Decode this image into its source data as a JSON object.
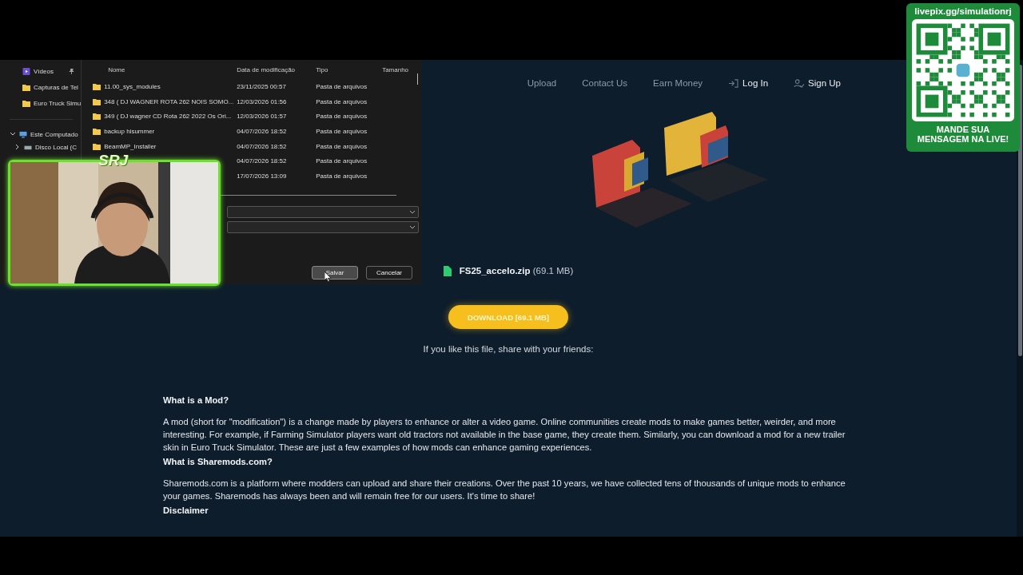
{
  "stream_overlay": {
    "channel_logo": "SRJ",
    "qr_panel": {
      "url": "livepix.gg/simulationrj",
      "message": "MANDE SUA\nMENSAGEM NA LIVE!"
    }
  },
  "save_dialog": {
    "sidebar": [
      {
        "label": "Vídeos",
        "kind": "video",
        "pinned": true
      },
      {
        "label": "Capturas de Tel",
        "kind": "folder",
        "pinned": false
      },
      {
        "label": "Euro Truck Simu",
        "kind": "folder",
        "pinned": false
      }
    ],
    "tree": [
      {
        "label": "Este Computado",
        "kind": "computer",
        "expanded": true,
        "children": [
          {
            "label": "Disco Local (C",
            "kind": "drive",
            "expanded": false
          }
        ]
      }
    ],
    "columns": [
      "Nome",
      "Data de modificação",
      "Tipo",
      "Tamanho"
    ],
    "rows": [
      {
        "name": "11.00_sys_modules",
        "modified": "23/11/2025 00:57",
        "type": "Pasta de arquivos"
      },
      {
        "name": "348 ( DJ WAGNER ROTA 262 NOIS SOMO...",
        "modified": "12/03/2026 01:56",
        "type": "Pasta de arquivos"
      },
      {
        "name": "349 ( DJ wagner CD Rota 262 2022 Os Ori...",
        "modified": "12/03/2026 01:57",
        "type": "Pasta de arquivos"
      },
      {
        "name": "backup hisummer",
        "modified": "04/07/2026 18:52",
        "type": "Pasta de arquivos"
      },
      {
        "name": "BeamMP_Installer",
        "modified": "04/07/2026 18:52",
        "type": "Pasta de arquivos"
      },
      {
        "modified": "04/07/2026 18:52",
        "type": "Pasta de arquivos"
      },
      {
        "modified": "17/07/2026 13:09",
        "type": "Pasta de arquivos"
      }
    ],
    "buttons": [
      {
        "label": "Salvar",
        "hovered": true
      },
      {
        "label": "Cancelar",
        "hovered": false
      }
    ]
  },
  "site": {
    "nav": [
      {
        "label": "Upload",
        "kind": "link"
      },
      {
        "label": "Contact Us",
        "kind": "link"
      },
      {
        "label": "Earn Money",
        "kind": "link"
      },
      {
        "label": "Log In",
        "kind": "login"
      },
      {
        "label": "Sign Up",
        "kind": "signup"
      }
    ],
    "file": {
      "name": "FS25_accelo.zip",
      "size": "(69.1 MB)"
    },
    "download_button": "DOWNLOAD [69.1 MB]",
    "share_text": "If you like this file, share with your friends:",
    "sections": [
      {
        "heading": "What is a Mod?",
        "body": "A mod (short for \"modification\") is a change made by players to enhance or alter a video game. Online communities create mods to make games better, weirder, and more interesting. For example, if Farming Simulator players want old tractors not available in the base game, they create them. Similarly, you can download a mod for a new trailer skin in Euro Truck Simulator. These are just a few examples of how mods can enhance gaming experiences."
      },
      {
        "heading": "What is Sharemods.com?",
        "body": "Sharemods.com is a platform where modders can upload and share their creations. Over the past 10 years, we have collected tens of thousands of unique mods to enhance your games. Sharemods has always been and will remain free for our users. It's time to share!"
      },
      {
        "heading": "Disclaimer"
      }
    ]
  }
}
